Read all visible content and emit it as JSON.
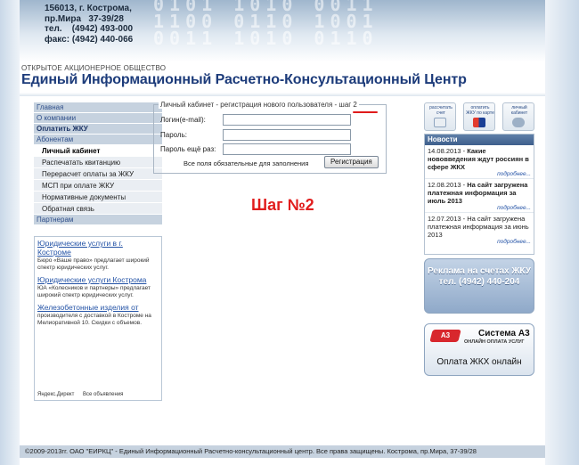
{
  "header": {
    "address_lines": "156013, г. Кострома,\nпр.Мира   37-39/28\nтел.    (4942) 493-000\nфакс: (4942) 440-066",
    "digits": "0101 1010 0011\n1100 0110 1001\n0011 1010 0110",
    "company_type": "ОТКРЫТОЕ АКЦИОНЕРНОЕ ОБЩЕСТВО",
    "company_name": "Единый Информационный Расчетно-Консультационный Центр"
  },
  "menu": {
    "top_items": [
      "Главная",
      "О компании",
      "Оплатить ЖКУ",
      "Абонентам"
    ],
    "sub_items": [
      "Личный кабинет",
      "Распечатать квитанцию",
      "Перерасчет оплаты за ЖКУ",
      "МСП при оплате ЖКУ",
      "Нормативные документы",
      "Обратная связь"
    ],
    "partners": "Партнерам"
  },
  "ads": {
    "items": [
      {
        "title": "Юридические услуги в г. Костроме",
        "desc": "Бюро «Ваше право» предлагает широкий спектр юридических услуг."
      },
      {
        "title": "Юридические услуги Кострома",
        "desc": "ЮА «Колесников и партнеры» предлагает широкий спектр юридических услуг."
      },
      {
        "title": "Железобетонные изделия от",
        "desc": "производителя с доставкой в Костроме на Мелиоративной 10. Скидки с объемов."
      }
    ],
    "footer_left": "Яндекс.Директ",
    "footer_right": "Все объявления"
  },
  "form": {
    "legend": "Личный кабинет - регистрация нового пользователя - шаг 2",
    "login_label": "Логин(e-mail):",
    "password_label": "Пароль:",
    "password2_label": "Пароль ещё раз:",
    "login_value": "",
    "password_value": "",
    "password2_value": "",
    "note": "Все поля обязательные для заполнения",
    "submit_label": "Регистрация"
  },
  "step_text": "Шаг №2",
  "quick": {
    "items": [
      "рассчитать счет",
      "оплатить ЖКУ по карте",
      "личный кабинет"
    ]
  },
  "news": {
    "heading": "Новости",
    "items": [
      {
        "date": "14.08.2013",
        "text": "Какие нововведения ждут россиян в сфере ЖКХ",
        "bold": true,
        "more": "подробнее..."
      },
      {
        "date": "12.08.2013",
        "text": "На сайт загружена платежная информация за июль 2013",
        "bold": true,
        "more": "подробнее..."
      },
      {
        "date": "12.07.2013",
        "text": "На сайт загружена платежная информация за июнь 2013",
        "bold": false,
        "more": "подробнее..."
      }
    ]
  },
  "promo_ad": "Реклама на счетах ЖКУ тел. (4942) 440-204",
  "promo_pay": {
    "logo": "A3",
    "system": "Система A3",
    "tagline": "ОНЛАЙН ОПЛАТА УСЛУГ",
    "action": "Оплата ЖКХ онлайн"
  },
  "footer": "©2009-2013гг. ОАО \"ЕИРКЦ\" - Единый Информационный Расчетно-консультационный центр. Все права защищены. Кострома, пр.Мира, 37-39/28",
  "colors": {
    "brand": "#1c3b7a",
    "accent": "#e11d1d",
    "menu_bg": "#c6d2df"
  }
}
